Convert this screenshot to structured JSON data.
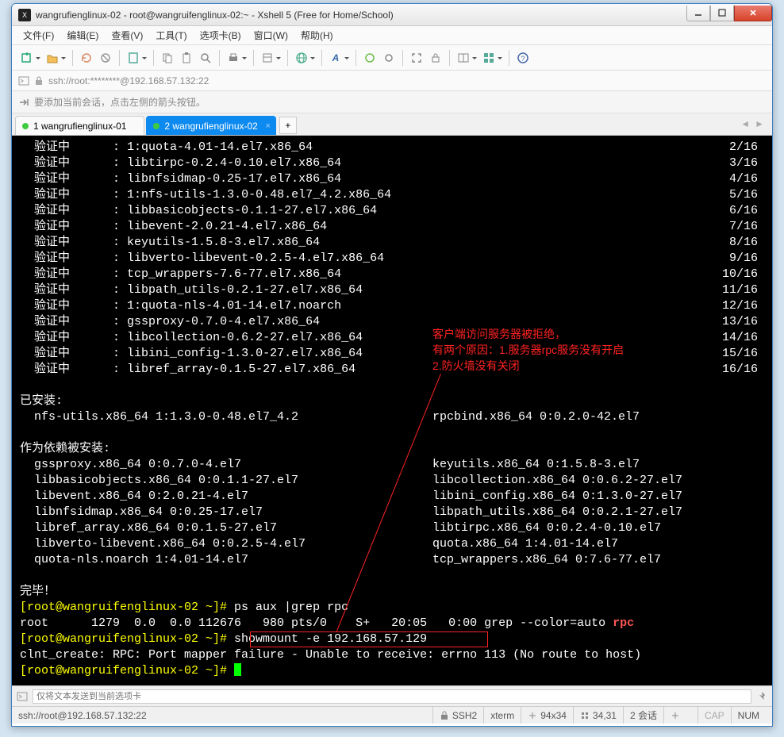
{
  "window_title": "wangrufienglinux-02 - root@wangruifenglinux-02:~ - Xshell 5 (Free for Home/School)",
  "menu": {
    "file": "文件(F)",
    "edit": "编辑(E)",
    "view": "查看(V)",
    "tools": "工具(T)",
    "tabs": "选项卡(B)",
    "window": "窗口(W)",
    "help": "帮助(H)"
  },
  "address": "ssh://root:********@192.168.57.132:22",
  "hint": "要添加当前会话，点击左侧的箭头按钮。",
  "tabs": {
    "t1": "1 wangrufienglinux-01",
    "t2": "2 wangrufienglinux-02",
    "add": "+"
  },
  "term": {
    "verify": "验证中",
    "lines": {
      "l1": {
        "pkg": "1:quota-4.01-14.el7.x86_64",
        "cnt": "2/16"
      },
      "l2": {
        "pkg": "libtirpc-0.2.4-0.10.el7.x86_64",
        "cnt": "3/16"
      },
      "l3": {
        "pkg": "libnfsidmap-0.25-17.el7.x86_64",
        "cnt": "4/16"
      },
      "l4": {
        "pkg": "1:nfs-utils-1.3.0-0.48.el7_4.2.x86_64",
        "cnt": "5/16"
      },
      "l5": {
        "pkg": "libbasicobjects-0.1.1-27.el7.x86_64",
        "cnt": "6/16"
      },
      "l6": {
        "pkg": "libevent-2.0.21-4.el7.x86_64",
        "cnt": "7/16"
      },
      "l7": {
        "pkg": "keyutils-1.5.8-3.el7.x86_64",
        "cnt": "8/16"
      },
      "l8": {
        "pkg": "libverto-libevent-0.2.5-4.el7.x86_64",
        "cnt": "9/16"
      },
      "l9": {
        "pkg": "tcp_wrappers-7.6-77.el7.x86_64",
        "cnt": "10/16"
      },
      "l10": {
        "pkg": "libpath_utils-0.2.1-27.el7.x86_64",
        "cnt": "11/16"
      },
      "l11": {
        "pkg": "1:quota-nls-4.01-14.el7.noarch",
        "cnt": "12/16"
      },
      "l12": {
        "pkg": "gssproxy-0.7.0-4.el7.x86_64",
        "cnt": "13/16"
      },
      "l13": {
        "pkg": "libcollection-0.6.2-27.el7.x86_64",
        "cnt": "14/16"
      },
      "l14": {
        "pkg": "libini_config-1.3.0-27.el7.x86_64",
        "cnt": "15/16"
      },
      "l15": {
        "pkg": "libref_array-0.1.5-27.el7.x86_64",
        "cnt": "16/16"
      }
    },
    "installed_hdr": "已安装:",
    "installed_l": "  nfs-utils.x86_64 1:1.3.0-0.48.el7_4.2",
    "installed_r": "rpcbind.x86_64 0:0.2.0-42.el7",
    "dep_hdr": "作为依赖被安装:",
    "dep": {
      "d1l": "  gssproxy.x86_64 0:0.7.0-4.el7",
      "d1r": "keyutils.x86_64 0:1.5.8-3.el7",
      "d2l": "  libbasicobjects.x86_64 0:0.1.1-27.el7",
      "d2r": "libcollection.x86_64 0:0.6.2-27.el7",
      "d3l": "  libevent.x86_64 0:2.0.21-4.el7",
      "d3r": "libini_config.x86_64 0:1.3.0-27.el7",
      "d4l": "  libnfsidmap.x86_64 0:0.25-17.el7",
      "d4r": "libpath_utils.x86_64 0:0.2.1-27.el7",
      "d5l": "  libref_array.x86_64 0:0.1.5-27.el7",
      "d5r": "libtirpc.x86_64 0:0.2.4-0.10.el7",
      "d6l": "  libverto-libevent.x86_64 0:0.2.5-4.el7",
      "d6r": "quota.x86_64 1:4.01-14.el7",
      "d7l": "  quota-nls.noarch 1:4.01-14.el7",
      "d7r": "tcp_wrappers.x86_64 0:7.6-77.el7"
    },
    "done": "完毕！",
    "p1_prompt": "[root@wangruifenglinux-02 ~]# ",
    "p1_cmd": "ps aux |grep rpc",
    "ps_a": "root      1279  0.0  0.0 112676   980 pts/0    S+   20:05   0:00 grep --color=auto ",
    "ps_b": "rpc",
    "p2_prompt": "[root@wangruifenglinux-02 ~]# ",
    "p2_cmd": "showmount -e 192.168.57.129",
    "err": "clnt_create: RPC: Port mapper failure - Unable to receive: errno 113 (No route to host)",
    "p3_prompt": "[root@wangruifenglinux-02 ~]# "
  },
  "annotation": {
    "l1": "客户端访问服务器被拒绝，",
    "l2": "有两个原因：1.服务器rpc服务没有开启",
    "l3": "2.防火墙没有关闭"
  },
  "sendbar_placeholder": "仅将文本发送到当前选项卡",
  "status": {
    "conn": "ssh://root@192.168.57.132:22",
    "ssh": "SSH2",
    "term": "xterm",
    "size": "94x34",
    "pos": "34,31",
    "sessions": "2 会话",
    "cap": "CAP",
    "num": "NUM"
  }
}
